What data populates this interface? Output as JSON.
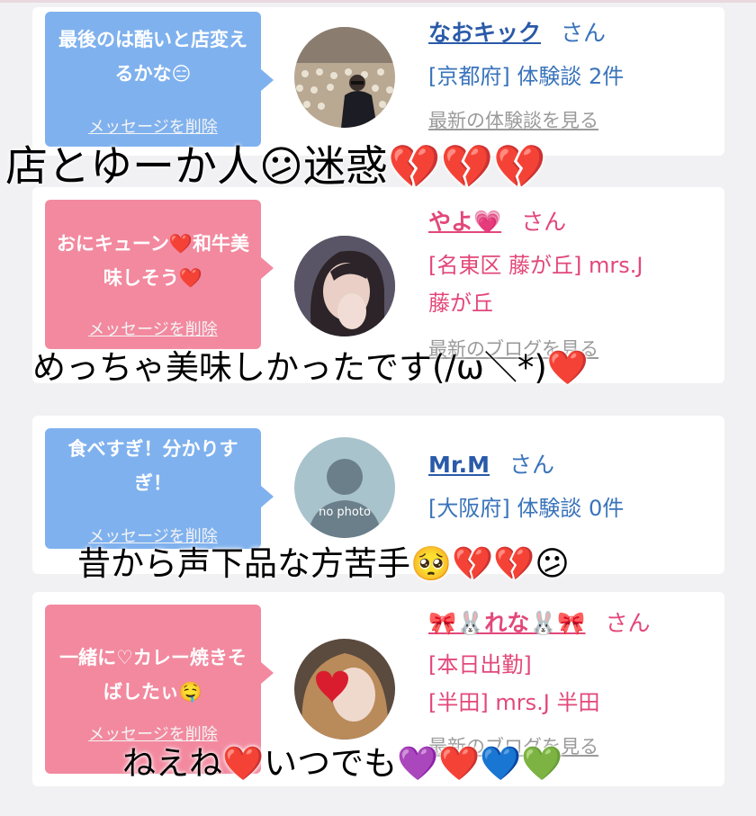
{
  "cards": [
    {
      "message": "最後のは酷いと店変えるかな😑",
      "delete_label": "メッセージを削除",
      "name": "なおキック",
      "honorific": "さん",
      "line1": "[京都府] 体験談 2件",
      "line2": "",
      "latest": "最新の体験談を見る"
    },
    {
      "message": "おにキューン❤️和牛美味しそう❤️",
      "delete_label": "メッセージを削除",
      "name": "やよ💗",
      "honorific": "さん",
      "line1": "[名東区 藤が丘] mrs.J",
      "line2": "藤が丘",
      "latest": "最新のブログを見る"
    },
    {
      "message": "食べすぎ！分かりすぎ！",
      "delete_label": "メッセージを削除",
      "name": "Mr.M",
      "honorific": "さん",
      "line1": "[大阪府] 体験談 0件",
      "line2": "",
      "latest": "",
      "avatar_text": "no photo"
    },
    {
      "message": "一緒に♡カレー焼きそばしたぃ🤤",
      "delete_label": "メッセージを削除",
      "name": "🎀🐰れな🐰🎀",
      "honorific": "さん",
      "line1": "[本日出勤]",
      "line2": "[半田] mrs.J 半田",
      "latest": "最新のブログを見る"
    }
  ],
  "captions": [
    "店とゆーか人😕迷惑💔💔💔",
    "めっちゃ美味しかったです(/ω＼*)❤️",
    "昔から声下品な方苦手🥺💔💔😕",
    "ねえね❤️いつでも💜❤️💙💚"
  ],
  "colors": {
    "blue_bubble": "#7fb1ee",
    "pink_bubble": "#f2899f",
    "blue_name": "#2a5aa8",
    "pink_name": "#e2487a"
  }
}
